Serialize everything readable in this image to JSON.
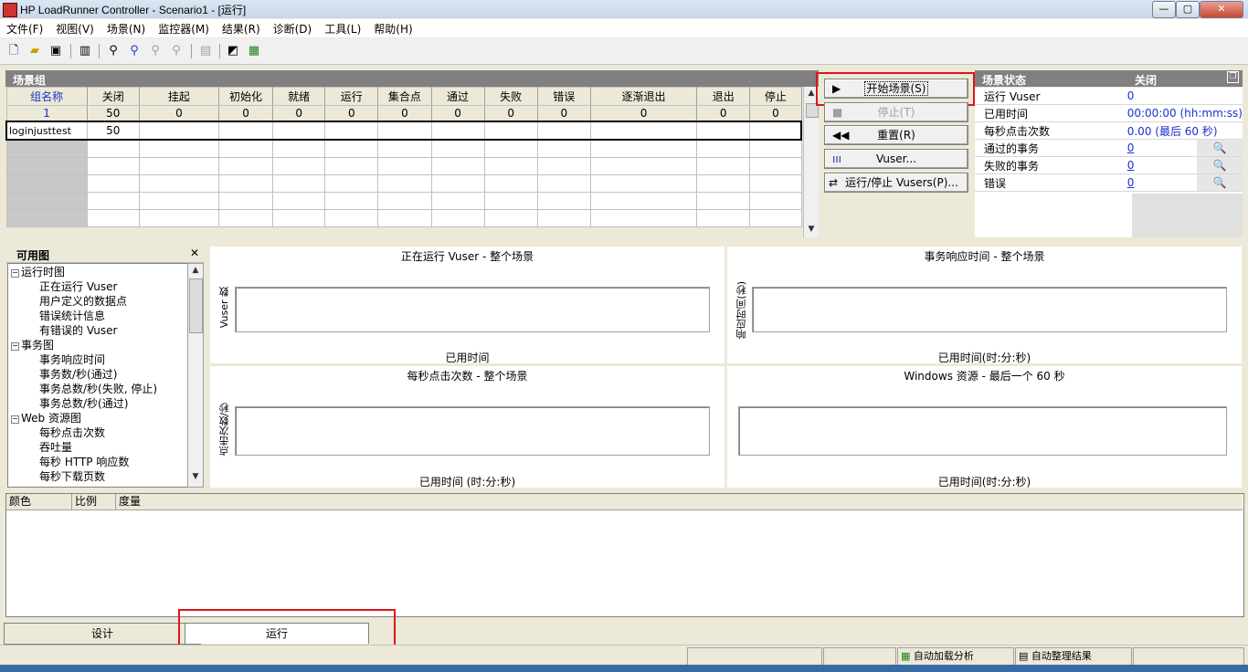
{
  "window": {
    "title": "HP LoadRunner Controller - Scenario1 - [运行]",
    "btn_min": "—",
    "btn_max": "▢",
    "btn_close": "✕"
  },
  "menu": [
    "文件(F)",
    "视图(V)",
    "场景(N)",
    "监控器(M)",
    "结果(R)",
    "诊断(D)",
    "工具(L)",
    "帮助(H)"
  ],
  "scenario_groups": {
    "title": "场景组",
    "headers": [
      "组名称",
      "关闭",
      "挂起",
      "初始化",
      "就绪",
      "运行",
      "集合点",
      "通过",
      "失败",
      "错误",
      "逐渐退出",
      "退出",
      "停止"
    ],
    "totals": [
      "1",
      "50",
      "0",
      "0",
      "0",
      "0",
      "0",
      "0",
      "0",
      "0",
      "0",
      "0",
      "0"
    ],
    "rows": [
      {
        "name": "loginjusttest",
        "closed": "50"
      }
    ]
  },
  "controls": {
    "start": "开始场景(S)",
    "stop": "停止(T)",
    "reset": "重置(R)",
    "vusers": "Vuser...",
    "run_stop_vusers": "运行/停止 Vusers(P)..."
  },
  "scenario_status": {
    "title": "场景状态",
    "state": "关闭",
    "rows": [
      {
        "label": "运行 Vuser",
        "value": "0",
        "link": false,
        "mag": false
      },
      {
        "label": "已用时间",
        "value": "00:00:00 (hh:mm:ss)",
        "link": false,
        "mag": false
      },
      {
        "label": "每秒点击次数",
        "value": "0.00 (最后 60 秒)",
        "link": false,
        "mag": false
      },
      {
        "label": "通过的事务",
        "value": "0",
        "link": true,
        "mag": true
      },
      {
        "label": "失败的事务",
        "value": "0",
        "link": true,
        "mag": true
      },
      {
        "label": "错误",
        "value": "0",
        "link": true,
        "mag": true
      }
    ]
  },
  "available_graphs": {
    "title": "可用图",
    "close": "✕",
    "tree": [
      {
        "label": "运行时图",
        "level": 0,
        "expander": "−"
      },
      {
        "label": "正在运行 Vuser",
        "level": 1
      },
      {
        "label": "用户定义的数据点",
        "level": 1
      },
      {
        "label": "错误统计信息",
        "level": 1
      },
      {
        "label": "有错误的 Vuser",
        "level": 1
      },
      {
        "label": "事务图",
        "level": 0,
        "expander": "−"
      },
      {
        "label": "事务响应时间",
        "level": 1
      },
      {
        "label": "事务数/秒(通过)",
        "level": 1
      },
      {
        "label": "事务总数/秒(失败, 停止)",
        "level": 1
      },
      {
        "label": "事务总数/秒(通过)",
        "level": 1
      },
      {
        "label": "Web 资源图",
        "level": 0,
        "expander": "−"
      },
      {
        "label": "每秒点击次数",
        "level": 1
      },
      {
        "label": "吞吐量",
        "level": 1
      },
      {
        "label": "每秒 HTTP 响应数",
        "level": 1
      },
      {
        "label": "每秒下载页数",
        "level": 1
      }
    ]
  },
  "graphs": [
    {
      "title": "正在运行 Vuser - 整个场景",
      "ylabel": "Vuser 数",
      "xlabel": "已用时间"
    },
    {
      "title": "事务响应时间 - 整个场景",
      "ylabel": "响应时间(秒)",
      "xlabel": "已用时间(时:分:秒)"
    },
    {
      "title": "每秒点击次数 - 整个场景",
      "ylabel": "点击次数/秒",
      "xlabel": "已用时间 (时:分:秒)"
    },
    {
      "title": "Windows 资源 - 最后一个 60 秒",
      "ylabel": "",
      "xlabel": "已用时间(时:分:秒)"
    }
  ],
  "legend": {
    "headers": [
      "颜色",
      "比例",
      "度量"
    ]
  },
  "tabs": {
    "design": "设计",
    "run": "运行"
  },
  "statusbar": {
    "auto_load": "自动加载分析",
    "auto_collate": "自动整理结果"
  }
}
